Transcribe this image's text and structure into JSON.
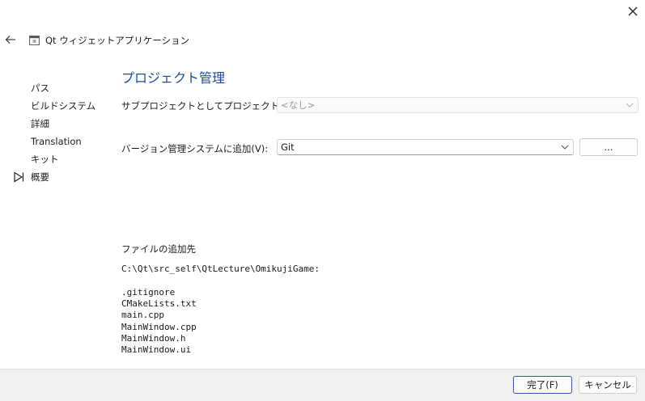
{
  "window": {
    "title": "Qt ウィジェットアプリケーション",
    "close_icon": "close-icon",
    "back_icon": "back-arrow-icon",
    "app_icon": "app-icon"
  },
  "sidebar": {
    "items": [
      {
        "label": "パス",
        "current": false
      },
      {
        "label": "ビルドシステム",
        "current": false
      },
      {
        "label": "詳細",
        "current": false
      },
      {
        "label": "Translation",
        "current": false
      },
      {
        "label": "キット",
        "current": false
      },
      {
        "label": "概要",
        "current": true
      }
    ]
  },
  "page": {
    "title": "プロジェクト管理",
    "subproject": {
      "label": "サブプロジェクトとしてプロジェクトに追加:",
      "value": "<なし>",
      "disabled": true
    },
    "vcs": {
      "label": "バージョン管理システムに追加(V):",
      "value": "Git",
      "configure_label": "..."
    },
    "summary": {
      "heading": "ファイルの追加先",
      "directory": "C:\\Qt\\src_self\\QtLecture\\OmikujiGame:",
      "files": [
        ".gitignore",
        "CMakeLists.txt",
        "main.cpp",
        "MainWindow.cpp",
        "MainWindow.h",
        "MainWindow.ui"
      ]
    }
  },
  "footer": {
    "finish_label": "完了(F)",
    "cancel_label": "キャンセル"
  },
  "colors": {
    "title": "#1a4d8f",
    "primary_border": "#2b5fa8",
    "footer_bg": "#f1f1f1"
  }
}
